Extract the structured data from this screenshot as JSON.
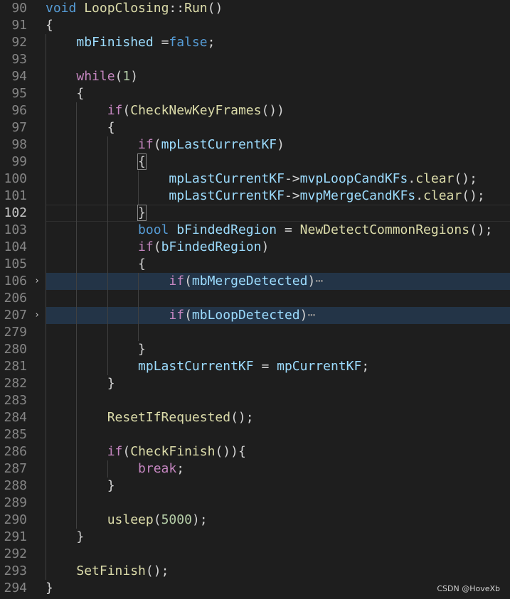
{
  "editor": {
    "lines": [
      {
        "n": "90",
        "code": [
          [
            "kw",
            "void"
          ],
          [
            "pl",
            " "
          ],
          [
            "fn",
            "LoopClosing"
          ],
          [
            "pl",
            "::"
          ],
          [
            "fn",
            "Run"
          ],
          [
            "pl",
            "()"
          ]
        ]
      },
      {
        "n": "91",
        "code": [
          [
            "pl",
            "{"
          ]
        ]
      },
      {
        "n": "92",
        "code": [
          [
            "pl",
            "    "
          ],
          [
            "var",
            "mbFinished"
          ],
          [
            "pl",
            " ="
          ],
          [
            "kw",
            "false"
          ],
          [
            "pl",
            ";"
          ]
        ]
      },
      {
        "n": "93",
        "code": []
      },
      {
        "n": "94",
        "code": [
          [
            "pl",
            "    "
          ],
          [
            "ctl",
            "while"
          ],
          [
            "pl",
            "("
          ],
          [
            "num",
            "1"
          ],
          [
            "pl",
            ")"
          ]
        ]
      },
      {
        "n": "95",
        "code": [
          [
            "pl",
            "    {"
          ]
        ]
      },
      {
        "n": "96",
        "code": [
          [
            "pl",
            "        "
          ],
          [
            "ctl",
            "if"
          ],
          [
            "pl",
            "("
          ],
          [
            "fn",
            "CheckNewKeyFrames"
          ],
          [
            "pl",
            "())"
          ]
        ]
      },
      {
        "n": "97",
        "code": [
          [
            "pl",
            "        {"
          ]
        ]
      },
      {
        "n": "98",
        "code": [
          [
            "pl",
            "            "
          ],
          [
            "ctl",
            "if"
          ],
          [
            "pl",
            "("
          ],
          [
            "var",
            "mpLastCurrentKF"
          ],
          [
            "pl",
            ")"
          ]
        ]
      },
      {
        "n": "99",
        "code": [
          [
            "pl",
            "            "
          ],
          [
            "brk",
            "{"
          ]
        ]
      },
      {
        "n": "100",
        "code": [
          [
            "pl",
            "                "
          ],
          [
            "var",
            "mpLastCurrentKF"
          ],
          [
            "pl",
            "->"
          ],
          [
            "var",
            "mvpLoopCandKFs"
          ],
          [
            "pl",
            "."
          ],
          [
            "fn",
            "clear"
          ],
          [
            "pl",
            "();"
          ]
        ]
      },
      {
        "n": "101",
        "code": [
          [
            "pl",
            "                "
          ],
          [
            "var",
            "mpLastCurrentKF"
          ],
          [
            "pl",
            "->"
          ],
          [
            "var",
            "mvpMergeCandKFs"
          ],
          [
            "pl",
            "."
          ],
          [
            "fn",
            "clear"
          ],
          [
            "pl",
            "();"
          ]
        ]
      },
      {
        "n": "102",
        "code": [
          [
            "pl",
            "            "
          ],
          [
            "brk",
            "}"
          ]
        ],
        "current": true
      },
      {
        "n": "103",
        "code": [
          [
            "pl",
            "            "
          ],
          [
            "kw",
            "bool"
          ],
          [
            "pl",
            " "
          ],
          [
            "var",
            "bFindedRegion"
          ],
          [
            "pl",
            " = "
          ],
          [
            "fn",
            "NewDetectCommonRegions"
          ],
          [
            "pl",
            "();"
          ]
        ]
      },
      {
        "n": "104",
        "code": [
          [
            "pl",
            "            "
          ],
          [
            "ctl",
            "if"
          ],
          [
            "pl",
            "("
          ],
          [
            "var",
            "bFindedRegion"
          ],
          [
            "pl",
            ")"
          ]
        ]
      },
      {
        "n": "105",
        "code": [
          [
            "pl",
            "            {"
          ]
        ]
      },
      {
        "n": "106",
        "code": [
          [
            "pl",
            "                "
          ],
          [
            "ctl",
            "if"
          ],
          [
            "pl",
            "("
          ],
          [
            "var",
            "mbMergeDetected"
          ],
          [
            "pl",
            ")"
          ],
          [
            "el",
            "⋯"
          ]
        ],
        "folded": true
      },
      {
        "n": "206",
        "code": []
      },
      {
        "n": "207",
        "code": [
          [
            "pl",
            "                "
          ],
          [
            "ctl",
            "if"
          ],
          [
            "pl",
            "("
          ],
          [
            "var",
            "mbLoopDetected"
          ],
          [
            "pl",
            ")"
          ],
          [
            "el",
            "⋯"
          ]
        ],
        "folded": true
      },
      {
        "n": "279",
        "code": []
      },
      {
        "n": "280",
        "code": [
          [
            "pl",
            "            }"
          ]
        ]
      },
      {
        "n": "281",
        "code": [
          [
            "pl",
            "            "
          ],
          [
            "var",
            "mpLastCurrentKF"
          ],
          [
            "pl",
            " = "
          ],
          [
            "var",
            "mpCurrentKF"
          ],
          [
            "pl",
            ";"
          ]
        ]
      },
      {
        "n": "282",
        "code": [
          [
            "pl",
            "        }"
          ]
        ]
      },
      {
        "n": "283",
        "code": []
      },
      {
        "n": "284",
        "code": [
          [
            "pl",
            "        "
          ],
          [
            "fn",
            "ResetIfRequested"
          ],
          [
            "pl",
            "();"
          ]
        ]
      },
      {
        "n": "285",
        "code": []
      },
      {
        "n": "286",
        "code": [
          [
            "pl",
            "        "
          ],
          [
            "ctl",
            "if"
          ],
          [
            "pl",
            "("
          ],
          [
            "fn",
            "CheckFinish"
          ],
          [
            "pl",
            "()){"
          ]
        ]
      },
      {
        "n": "287",
        "code": [
          [
            "pl",
            "            "
          ],
          [
            "ctl",
            "break"
          ],
          [
            "pl",
            ";"
          ]
        ]
      },
      {
        "n": "288",
        "code": [
          [
            "pl",
            "        }"
          ]
        ]
      },
      {
        "n": "289",
        "code": []
      },
      {
        "n": "290",
        "code": [
          [
            "pl",
            "        "
          ],
          [
            "fn",
            "usleep"
          ],
          [
            "pl",
            "("
          ],
          [
            "num",
            "5000"
          ],
          [
            "pl",
            ");"
          ]
        ]
      },
      {
        "n": "291",
        "code": [
          [
            "pl",
            "    }"
          ]
        ]
      },
      {
        "n": "292",
        "code": []
      },
      {
        "n": "293",
        "code": [
          [
            "pl",
            "    "
          ],
          [
            "fn",
            "SetFinish"
          ],
          [
            "pl",
            "();"
          ]
        ]
      },
      {
        "n": "294",
        "code": [
          [
            "pl",
            "}"
          ]
        ]
      }
    ],
    "fold_marker": "›",
    "colors": {
      "background": "#1e1e1e",
      "keyword": "#569cd6",
      "control": "#c586c0",
      "function": "#dcdcaa",
      "variable": "#9cdcfe",
      "number": "#b5cea8",
      "plain": "#d4d4d4",
      "folded_line_bg": "#233447"
    }
  },
  "watermark": "CSDN @HoveXb"
}
